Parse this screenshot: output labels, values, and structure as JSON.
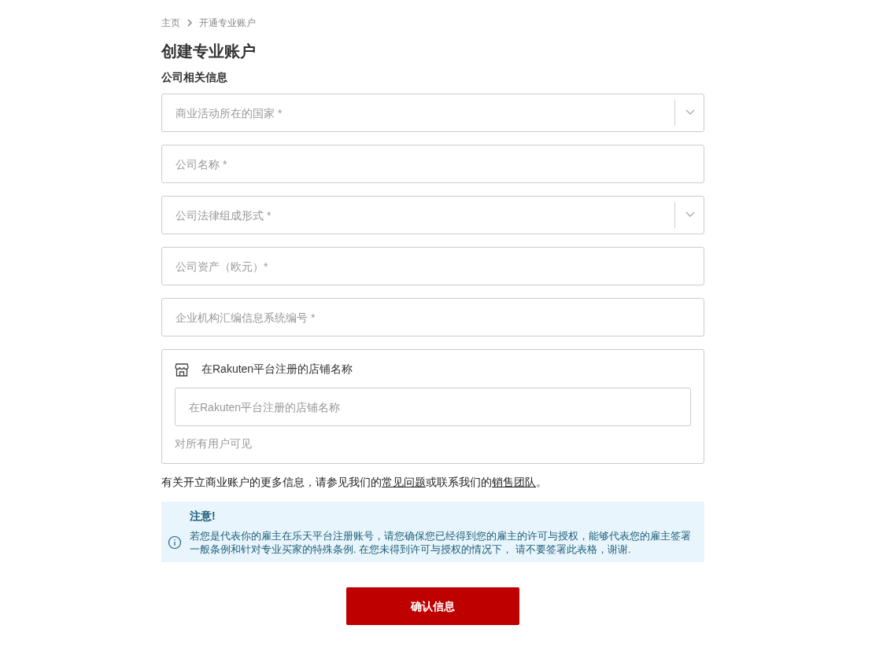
{
  "breadcrumb": [
    {
      "label": "主页"
    },
    {
      "label": "开通专业账户"
    }
  ],
  "title": "创建专业账户",
  "section_title": "公司相关信息",
  "fields": [
    {
      "kind": "select",
      "placeholder": "商业活动所在的国家 *"
    },
    {
      "kind": "text",
      "placeholder": "公司名称 *"
    },
    {
      "kind": "select",
      "placeholder": "公司法律组成形式 *"
    },
    {
      "kind": "text",
      "placeholder": "公司资产（欧元）*"
    },
    {
      "kind": "text",
      "placeholder": "企业机构汇编信息系统编号 *"
    }
  ],
  "store_card": {
    "label": "在Rakuten平台注册的店铺名称",
    "placeholder": "在Rakuten平台注册的店铺名称",
    "hint": "对所有用户可见"
  },
  "info": {
    "text_before": "有关开立商业账户的更多信息，请参见我们的",
    "link_1": "常见问题",
    "text_middle": "或联系我们的",
    "link_2": "销售团队",
    "text_after": "。"
  },
  "notice": {
    "title": "注意!",
    "body": "若您是代表你的雇主在乐天平台注册账号，请您确保您已经得到您的雇主的许可与授权，能够代表您的雇主签署一般条例和针对专业买家的特殊条例. 在您未得到许可与授权的情况下， 请不要签署此表格，谢谢."
  },
  "submit_button": "确认信息"
}
